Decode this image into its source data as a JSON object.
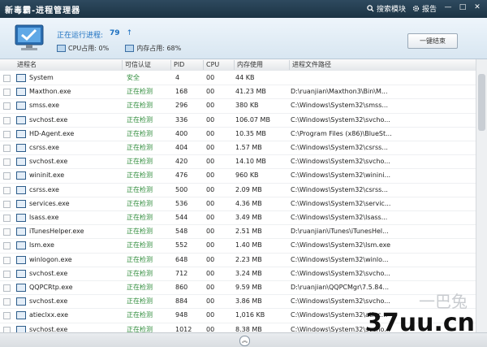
{
  "window": {
    "title": "新毒霸-进程管理器",
    "menu": [
      {
        "label": "搜索模块",
        "icon": "search-icon"
      },
      {
        "label": "报告",
        "icon": "gear-icon"
      }
    ],
    "controls": [
      "—",
      "□",
      "✕"
    ]
  },
  "header": {
    "running_label": "正在运行进程:",
    "running_count": "79",
    "running_arrow": "↑",
    "cpu_label": "CPU占用: 0%",
    "mem_label": "内存占用: 68%",
    "end_button": "一键结束"
  },
  "columns": [
    "进程名",
    "可信认证",
    "PID",
    "CPU",
    "内存使用",
    "进程文件路径"
  ],
  "rows": [
    {
      "name": "System",
      "status": "安全",
      "pid": "4",
      "cpu": "00",
      "mem": "44 KB",
      "path": ""
    },
    {
      "name": "Maxthon.exe",
      "status": "正在检测",
      "pid": "168",
      "cpu": "00",
      "mem": "41.23 MB",
      "path": "D:\\ruanjian\\Maxthon3\\Bin\\M..."
    },
    {
      "name": "smss.exe",
      "status": "正在检测",
      "pid": "296",
      "cpu": "00",
      "mem": "380 KB",
      "path": "C:\\Windows\\System32\\smss..."
    },
    {
      "name": "svchost.exe",
      "status": "正在检测",
      "pid": "336",
      "cpu": "00",
      "mem": "106.07 MB",
      "path": "C:\\Windows\\System32\\svcho..."
    },
    {
      "name": "HD-Agent.exe",
      "status": "正在检测",
      "pid": "400",
      "cpu": "00",
      "mem": "10.35 MB",
      "path": "C:\\Program Files (x86)\\BlueSt..."
    },
    {
      "name": "csrss.exe",
      "status": "正在检测",
      "pid": "404",
      "cpu": "00",
      "mem": "1.57 MB",
      "path": "C:\\Windows\\System32\\csrss..."
    },
    {
      "name": "svchost.exe",
      "status": "正在检测",
      "pid": "420",
      "cpu": "00",
      "mem": "14.10 MB",
      "path": "C:\\Windows\\System32\\svcho..."
    },
    {
      "name": "wininit.exe",
      "status": "正在检测",
      "pid": "476",
      "cpu": "00",
      "mem": "960 KB",
      "path": "C:\\Windows\\System32\\winini..."
    },
    {
      "name": "csrss.exe",
      "status": "正在检测",
      "pid": "500",
      "cpu": "00",
      "mem": "2.09 MB",
      "path": "C:\\Windows\\System32\\csrss..."
    },
    {
      "name": "services.exe",
      "status": "正在检测",
      "pid": "536",
      "cpu": "00",
      "mem": "4.36 MB",
      "path": "C:\\Windows\\System32\\servic..."
    },
    {
      "name": "lsass.exe",
      "status": "正在检测",
      "pid": "544",
      "cpu": "00",
      "mem": "3.49 MB",
      "path": "C:\\Windows\\System32\\lsass..."
    },
    {
      "name": "iTunesHelper.exe",
      "status": "正在检测",
      "pid": "548",
      "cpu": "00",
      "mem": "2.51 MB",
      "path": "D:\\ruanjian\\iTunes\\iTunesHel..."
    },
    {
      "name": "lsm.exe",
      "status": "正在检测",
      "pid": "552",
      "cpu": "00",
      "mem": "1.40 MB",
      "path": "C:\\Windows\\System32\\lsm.exe"
    },
    {
      "name": "winlogon.exe",
      "status": "正在检测",
      "pid": "648",
      "cpu": "00",
      "mem": "2.23 MB",
      "path": "C:\\Windows\\System32\\winlo..."
    },
    {
      "name": "svchost.exe",
      "status": "正在检测",
      "pid": "712",
      "cpu": "00",
      "mem": "3.24 MB",
      "path": "C:\\Windows\\System32\\svcho..."
    },
    {
      "name": "QQPCRtp.exe",
      "status": "正在检测",
      "pid": "860",
      "cpu": "00",
      "mem": "9.59 MB",
      "path": "D:\\ruanjian\\QQPCMgr\\7.5.84..."
    },
    {
      "name": "svchost.exe",
      "status": "正在检测",
      "pid": "884",
      "cpu": "00",
      "mem": "3.86 MB",
      "path": "C:\\Windows\\System32\\svcho..."
    },
    {
      "name": "atieclxx.exe",
      "status": "正在检测",
      "pid": "948",
      "cpu": "00",
      "mem": "1,016 KB",
      "path": "C:\\Windows\\System32\\atiec..."
    },
    {
      "name": "svchost.exe",
      "status": "正在检测",
      "pid": "1012",
      "cpu": "00",
      "mem": "8.38 MB",
      "path": "C:\\Windows\\System32\\svcho..."
    }
  ],
  "footer": {
    "collapse": "︽"
  },
  "watermark": {
    "text": "37uu.cn",
    "faint": "一巴兔"
  },
  "colors": {
    "accent": "#1a6fc0",
    "status_safe": "#2e8b3a",
    "titlebar": "#1c3344"
  }
}
